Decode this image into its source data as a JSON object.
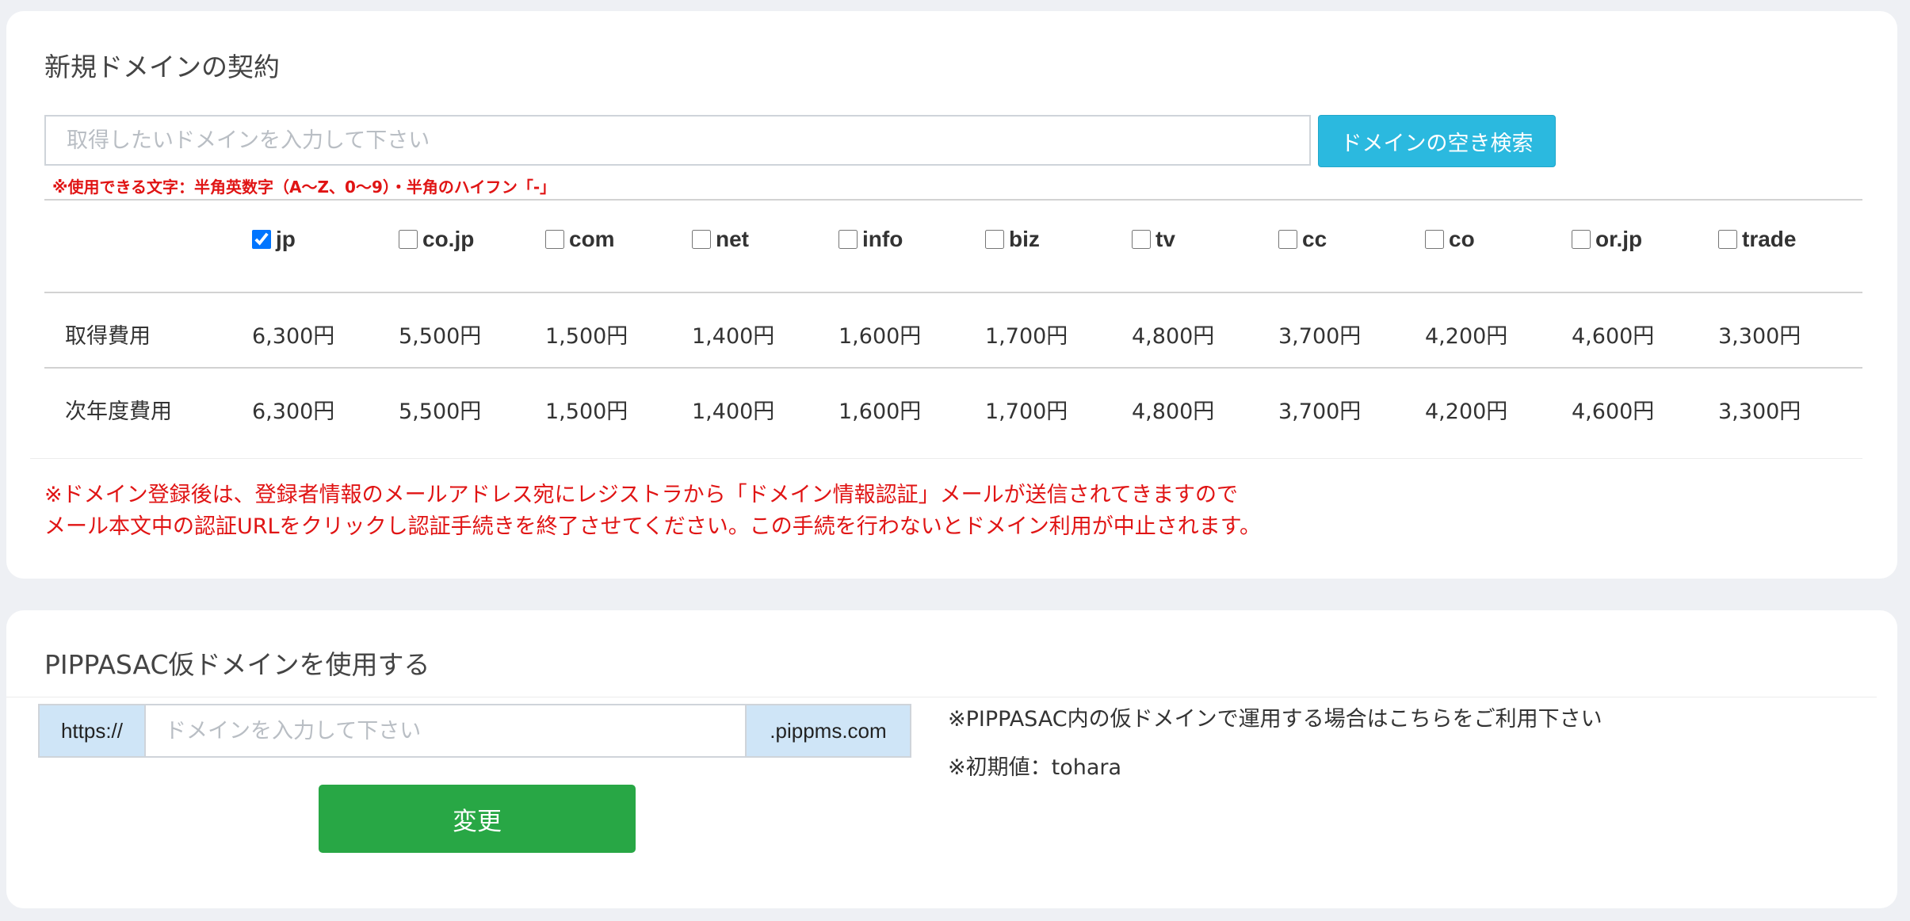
{
  "new_domain": {
    "title": "新規ドメインの契約",
    "search_placeholder": "取得したいドメインを入力して下さい",
    "search_button": "ドメインの空き検索",
    "allowed_chars_note": "※使用できる文字：半角英数字（A〜Z、0〜9）・半角のハイフン「-」",
    "tlds": [
      {
        "label": "jp",
        "checked": true
      },
      {
        "label": "co.jp",
        "checked": false
      },
      {
        "label": "com",
        "checked": false
      },
      {
        "label": "net",
        "checked": false
      },
      {
        "label": "info",
        "checked": false
      },
      {
        "label": "biz",
        "checked": false
      },
      {
        "label": "tv",
        "checked": false
      },
      {
        "label": "cc",
        "checked": false
      },
      {
        "label": "co",
        "checked": false
      },
      {
        "label": "or.jp",
        "checked": false
      },
      {
        "label": "trade",
        "checked": false
      }
    ],
    "rows": [
      {
        "label": "取得費用",
        "prices": [
          "6,300円",
          "5,500円",
          "1,500円",
          "1,400円",
          "1,600円",
          "1,700円",
          "4,800円",
          "3,700円",
          "4,200円",
          "4,600円",
          "3,300円"
        ]
      },
      {
        "label": "次年度費用",
        "prices": [
          "6,300円",
          "5,500円",
          "1,500円",
          "1,400円",
          "1,600円",
          "1,700円",
          "4,800円",
          "3,700円",
          "4,200円",
          "4,600円",
          "3,300円"
        ]
      }
    ],
    "notice_line1": "※ドメイン登録後は、登録者情報のメールアドレス宛にレジストラから「ドメイン情報認証」メールが送信されてきますので",
    "notice_line2": "メール本文中の認証URLをクリックし認証手続きを終了させてください。この手続を行わないとドメイン利用が中止されます。"
  },
  "temp_domain": {
    "title": "PIPPASAC仮ドメインを使用する",
    "prefix": "https://",
    "input_placeholder": "ドメインを入力して下さい",
    "suffix": ".pippms.com",
    "change_button": "変更",
    "info_line1": "※PIPPASAC内の仮ドメインで運用する場合はこちらをご利用下さい",
    "info_line2": "※初期値：tohara"
  },
  "colors": {
    "accent_blue": "#2bb9df",
    "success_green": "#28a745",
    "alert_red": "#e01414",
    "addon_bg": "#cfe5f7"
  }
}
